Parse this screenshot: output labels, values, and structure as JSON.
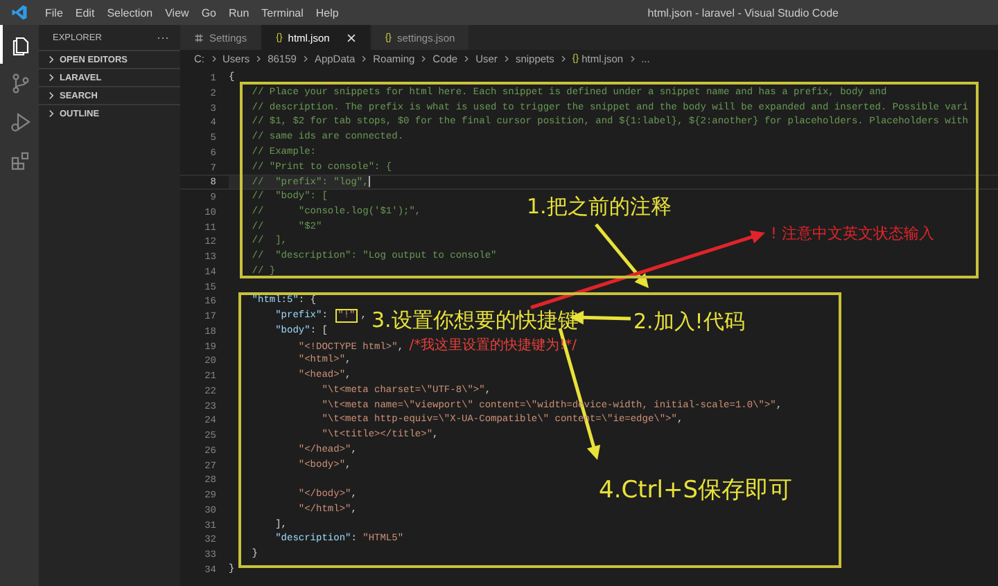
{
  "title_bar": {
    "menu": [
      "File",
      "Edit",
      "Selection",
      "View",
      "Go",
      "Run",
      "Terminal",
      "Help"
    ],
    "title": "html.json - laravel - Visual Studio Code"
  },
  "activity_bar": [
    {
      "kind": "explorer",
      "selected": true
    },
    {
      "kind": "source-control",
      "selected": false
    },
    {
      "kind": "run",
      "selected": false
    },
    {
      "kind": "extensions",
      "selected": false
    }
  ],
  "sidebar": {
    "title": "EXPLORER",
    "more": "···",
    "sections": [
      {
        "label": "OPEN EDITORS",
        "expanded": false
      },
      {
        "label": "LARAVEL",
        "expanded": false
      },
      {
        "label": "SEARCH",
        "expanded": false
      },
      {
        "label": "OUTLINE",
        "expanded": false
      }
    ]
  },
  "tabs": [
    {
      "kind": "settings",
      "label": "Settings",
      "selected": false
    },
    {
      "kind": "json",
      "icon": "{}",
      "label": "html.json",
      "selected": true
    },
    {
      "kind": "json",
      "icon": "{}",
      "label": "settings.json",
      "selected": false
    }
  ],
  "breadcrumb": [
    {
      "text": "C:"
    },
    {
      "text": "Users"
    },
    {
      "text": "86159"
    },
    {
      "text": "AppData"
    },
    {
      "text": "Roaming"
    },
    {
      "text": "Code"
    },
    {
      "text": "User"
    },
    {
      "text": "snippets"
    },
    {
      "icon": "{}",
      "text": "html.json"
    },
    {
      "text": "..."
    }
  ],
  "editor": {
    "lines": [
      {
        "number": "1",
        "current": false,
        "tokens": [
          {
            "kind": "punct",
            "text": "{"
          }
        ]
      },
      {
        "number": "2",
        "current": false,
        "tokens": [
          {
            "kind": "comment",
            "text": "    // Place your snippets for html here. Each snippet is defined under a snippet name and has a prefix, body and"
          }
        ]
      },
      {
        "number": "3",
        "current": false,
        "tokens": [
          {
            "kind": "comment",
            "text": "    // description. The prefix is what is used to trigger the snippet and the body will be expanded and inserted. Possible vari"
          }
        ]
      },
      {
        "number": "4",
        "current": false,
        "tokens": [
          {
            "kind": "comment",
            "text": "    // $1, $2 for tab stops, $0 for the final cursor position, and ${1:label}, ${2:another} for placeholders. Placeholders with"
          }
        ]
      },
      {
        "number": "5",
        "current": false,
        "tokens": [
          {
            "kind": "comment",
            "text": "    // same ids are connected."
          }
        ]
      },
      {
        "number": "6",
        "current": false,
        "tokens": [
          {
            "kind": "comment",
            "text": "    // Example:"
          }
        ]
      },
      {
        "number": "7",
        "current": false,
        "tokens": [
          {
            "kind": "comment",
            "text": "    // \"Print to console\": {"
          }
        ]
      },
      {
        "number": "8",
        "current": true,
        "tokens": [
          {
            "kind": "comment",
            "text": "    //  \"prefix\": \"log\","
          }
        ]
      },
      {
        "number": "9",
        "current": false,
        "tokens": [
          {
            "kind": "comment",
            "text": "    //  \"body\": ["
          }
        ]
      },
      {
        "number": "10",
        "current": false,
        "tokens": [
          {
            "kind": "comment",
            "text": "    //      \"console.log('$1');\","
          }
        ]
      },
      {
        "number": "11",
        "current": false,
        "tokens": [
          {
            "kind": "comment",
            "text": "    //      \"$2\""
          }
        ]
      },
      {
        "number": "12",
        "current": false,
        "tokens": [
          {
            "kind": "comment",
            "text": "    //  ],"
          }
        ]
      },
      {
        "number": "13",
        "current": false,
        "tokens": [
          {
            "kind": "comment",
            "text": "    //  \"description\": \"Log output to console\""
          }
        ]
      },
      {
        "number": "14",
        "current": false,
        "tokens": [
          {
            "kind": "comment",
            "text": "    // }"
          }
        ]
      },
      {
        "number": "15",
        "current": false
      },
      {
        "number": "16",
        "current": false,
        "tokens": [
          {
            "kind": "key",
            "text": "    \"html:5\""
          },
          {
            "kind": "punct",
            "text": ": {"
          }
        ]
      },
      {
        "number": "17",
        "current": false,
        "tokens": [
          {
            "kind": "key",
            "text": "        \"prefix\""
          },
          {
            "kind": "punct",
            "text": ": "
          },
          {
            "kind": "string",
            "text": "\"!\"",
            "boxed": true
          },
          {
            "kind": "punct",
            "text": ","
          }
        ]
      },
      {
        "number": "18",
        "current": false,
        "tokens": [
          {
            "kind": "key",
            "text": "        \"body\""
          },
          {
            "kind": "punct",
            "text": ": ["
          }
        ]
      },
      {
        "number": "19",
        "current": false,
        "tokens": [
          {
            "kind": "string",
            "text": "            \"<!DOCTYPE html>\""
          },
          {
            "kind": "punct",
            "text": ", "
          },
          {
            "kind": "note",
            "text": "/*我这里设置的快捷键为!*/"
          }
        ]
      },
      {
        "number": "20",
        "current": false,
        "tokens": [
          {
            "kind": "string",
            "text": "            \"<html>\""
          },
          {
            "kind": "punct",
            "text": ","
          }
        ]
      },
      {
        "number": "21",
        "current": false,
        "tokens": [
          {
            "kind": "string",
            "text": "            \"<head>\""
          },
          {
            "kind": "punct",
            "text": ","
          }
        ]
      },
      {
        "number": "22",
        "current": false,
        "tokens": [
          {
            "kind": "string",
            "text": "                \"\\t<meta charset=\\\"UTF-8\\\">\""
          },
          {
            "kind": "punct",
            "text": ","
          }
        ]
      },
      {
        "number": "23",
        "current": false,
        "tokens": [
          {
            "kind": "string",
            "text": "                \"\\t<meta name=\\\"viewport\\\" content=\\\"width=device-width, initial-scale=1.0\\\">\""
          },
          {
            "kind": "punct",
            "text": ","
          }
        ]
      },
      {
        "number": "24",
        "current": false,
        "tokens": [
          {
            "kind": "string",
            "text": "                \"\\t<meta http-equiv=\\\"X-UA-Compatible\\\" content=\\\"ie=edge\\\">\""
          },
          {
            "kind": "punct",
            "text": ","
          }
        ]
      },
      {
        "number": "25",
        "current": false,
        "tokens": [
          {
            "kind": "string",
            "text": "                \"\\t<title></title>\""
          },
          {
            "kind": "punct",
            "text": ","
          }
        ]
      },
      {
        "number": "26",
        "current": false,
        "tokens": [
          {
            "kind": "string",
            "text": "            \"</head>\""
          },
          {
            "kind": "punct",
            "text": ","
          }
        ]
      },
      {
        "number": "27",
        "current": false,
        "tokens": [
          {
            "kind": "string",
            "text": "            \"<body>\""
          },
          {
            "kind": "punct",
            "text": ","
          }
        ]
      },
      {
        "number": "28",
        "current": false
      },
      {
        "number": "29",
        "current": false,
        "tokens": [
          {
            "kind": "string",
            "text": "            \"</body>\""
          },
          {
            "kind": "punct",
            "text": ","
          }
        ]
      },
      {
        "number": "30",
        "current": false,
        "tokens": [
          {
            "kind": "string",
            "text": "            \"</html>\""
          },
          {
            "kind": "punct",
            "text": ","
          }
        ]
      },
      {
        "number": "31",
        "current": false,
        "tokens": [
          {
            "kind": "punct",
            "text": "        ],"
          }
        ]
      },
      {
        "number": "32",
        "current": false,
        "tokens": [
          {
            "kind": "key",
            "text": "        \"description\""
          },
          {
            "kind": "punct",
            "text": ": "
          },
          {
            "kind": "string",
            "text": "\"HTML5\""
          }
        ]
      },
      {
        "number": "33",
        "current": false,
        "tokens": [
          {
            "kind": "punct",
            "text": "    }"
          }
        ]
      },
      {
        "number": "34",
        "current": false,
        "tokens": [
          {
            "kind": "punct",
            "text": "}"
          }
        ]
      }
    ]
  },
  "annotations": [
    {
      "text": "1.把之前的注释",
      "color": "#e8e23a"
    },
    {
      "text": "! 注意中文英文状态输入",
      "color": "#e0242a"
    },
    {
      "text": "3.设置你想要的快捷键",
      "color": "#e8e23a"
    },
    {
      "text": "2.加入!代码",
      "color": "#e8e23a"
    },
    {
      "text": "4.Ctrl+S保存即可",
      "color": "#e8e23a"
    }
  ]
}
